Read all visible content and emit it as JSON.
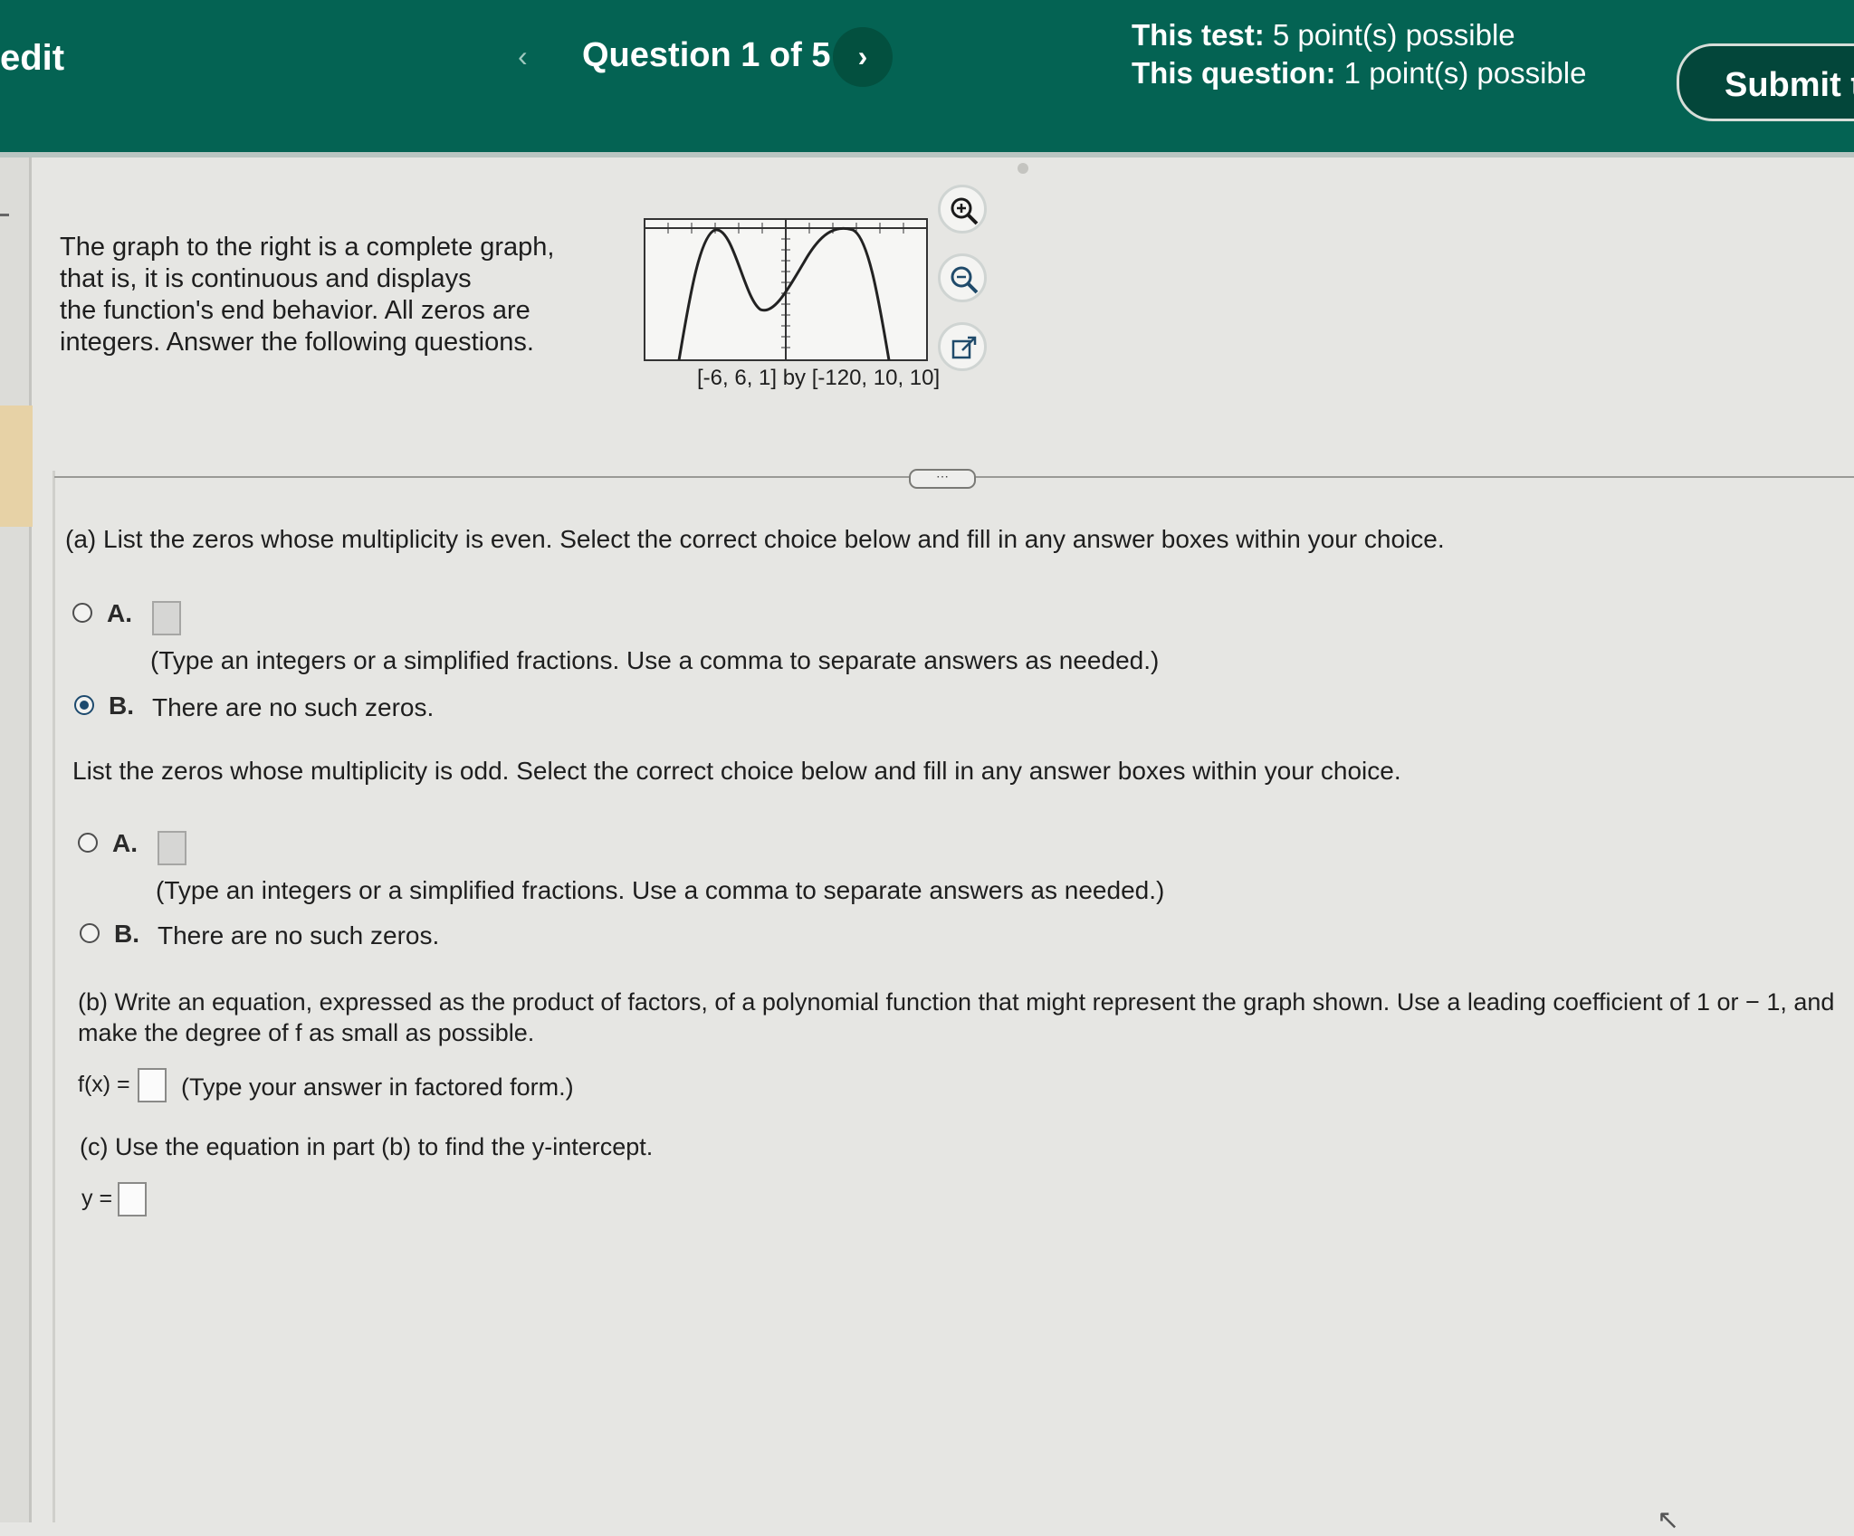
{
  "header": {
    "brand_fragment": "edit",
    "prev_arrow": "‹",
    "question_title": "Question 1 of 5",
    "next_arrow": "›",
    "test_points_label": "This test:",
    "test_points_value": "5 point(s) possible",
    "question_points_label": "This question:",
    "question_points_value": "1 point(s) possible",
    "submit_label": "Submit t"
  },
  "problem": {
    "intro_lines": [
      "The graph to the right is a complete graph,",
      "that is, it is continuous and displays",
      "the function's end behavior. All zeros are",
      "integers. Answer the following questions."
    ],
    "graph_window": "[-6, 6, 1] by [-120, 10, 10]"
  },
  "more_button": "⋯",
  "part_a": {
    "even_prompt": "(a) List the zeros whose multiplicity is even. Select the correct choice below and fill in any answer boxes within your choice.",
    "even_choice_a_letter": "A.",
    "even_choice_a_hint": "(Type an integers or a simplified fractions. Use a comma to separate answers as needed.)",
    "even_choice_b_letter": "B.",
    "even_choice_b_text": "There are no such zeros.",
    "even_selected": "B",
    "odd_prompt": "List the zeros whose multiplicity is odd. Select the correct choice below and fill in any answer boxes within your choice.",
    "odd_choice_a_letter": "A.",
    "odd_choice_a_hint": "(Type an integers or a simplified fractions. Use a comma to separate answers as needed.)",
    "odd_choice_b_letter": "B.",
    "odd_choice_b_text": "There are no such zeros."
  },
  "part_b": {
    "prompt_line1": "(b) Write an equation, expressed as the product of factors, of a polynomial function that might represent the graph shown. Use a leading coefficient of 1 or − 1, and",
    "prompt_line2": "make the degree of f as small as possible.",
    "fx_label": "f(x) =",
    "fx_hint": "(Type your answer in factored form.)"
  },
  "part_c": {
    "prompt": "(c) Use the equation in part (b) to find the y-intercept.",
    "y_label": "y ="
  },
  "colors": {
    "header": "#046353",
    "selected_radio": "#1d4a6e",
    "page_background": "#e6e6e3"
  }
}
